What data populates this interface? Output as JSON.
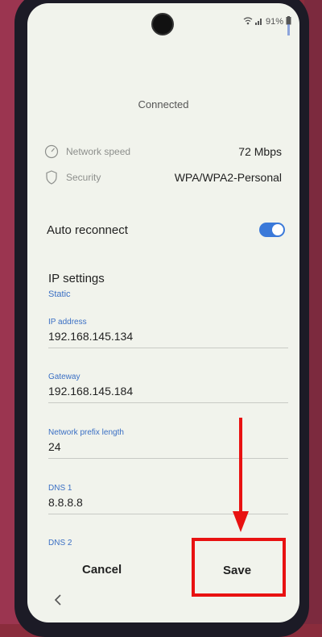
{
  "status_bar": {
    "battery": "91%"
  },
  "header": {
    "status": "Connected"
  },
  "info": [
    {
      "label": "Network speed",
      "value": "72 Mbps",
      "icon": "gauge-icon"
    },
    {
      "label": "Security",
      "value": "WPA/WPA2-Personal",
      "icon": "shield-icon"
    }
  ],
  "auto_reconnect": {
    "label": "Auto reconnect",
    "enabled": true
  },
  "ip_settings": {
    "title": "IP settings",
    "mode": "Static"
  },
  "fields": {
    "ip_address": {
      "label": "IP address",
      "value": "192.168.145.134"
    },
    "gateway": {
      "label": "Gateway",
      "value": "192.168.145.184"
    },
    "prefix": {
      "label": "Network prefix length",
      "value": "24"
    },
    "dns1": {
      "label": "DNS 1",
      "value": "8.8.8.8"
    },
    "dns2": {
      "label": "DNS 2"
    }
  },
  "actions": {
    "cancel": "Cancel",
    "save": "Save"
  },
  "annotation_color": "#e81111"
}
